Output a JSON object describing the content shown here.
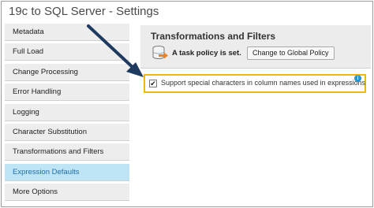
{
  "window": {
    "title": "19c to SQL Server - Settings"
  },
  "sidebar": {
    "items": [
      {
        "label": "Metadata",
        "name": "sidebar-item-metadata",
        "active": false
      },
      {
        "label": "Full Load",
        "name": "sidebar-item-full-load",
        "active": false
      },
      {
        "label": "Change Processing",
        "name": "sidebar-item-change-processing",
        "active": false
      },
      {
        "label": "Error Handling",
        "name": "sidebar-item-error-handling",
        "active": false
      },
      {
        "label": "Logging",
        "name": "sidebar-item-logging",
        "active": false
      },
      {
        "label": "Character Substitution",
        "name": "sidebar-item-character-substitution",
        "active": false
      },
      {
        "label": "Transformations and Filters",
        "name": "sidebar-item-transformations-and-filters",
        "active": false
      },
      {
        "label": "Expression Defaults",
        "name": "sidebar-item-expression-defaults",
        "active": true
      },
      {
        "label": "More Options",
        "name": "sidebar-item-more-options",
        "active": false
      }
    ]
  },
  "main": {
    "title": "Transformations and Filters",
    "policy_status": "A task policy is set.",
    "policy_button": "Change to Global Policy",
    "checkbox_label": "Support special characters in column names used in expressions",
    "checkbox_checked": true,
    "info_icon": "i"
  },
  "colors": {
    "active_item_bg": "#bfe4f5",
    "active_item_text": "#1f6fa8",
    "highlight_border": "#f2b90c",
    "arrow": "#1f3a5f",
    "info_icon": "#2d8fd5"
  }
}
